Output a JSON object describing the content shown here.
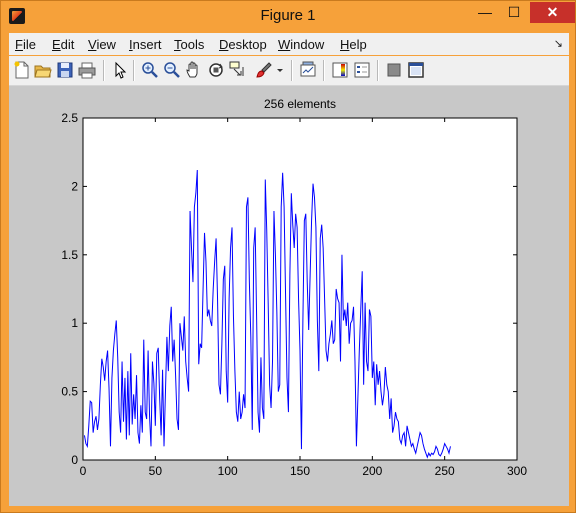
{
  "window": {
    "title": "Figure 1",
    "minimize": "—",
    "maximize": "☐",
    "close": "✕"
  },
  "menu": [
    "File",
    "Edit",
    "View",
    "Insert",
    "Tools",
    "Desktop",
    "Window",
    "Help"
  ],
  "menu_dock_glyph": "↘",
  "toolbar_icons": [
    "new-figure-icon",
    "open-file-icon",
    "save-icon",
    "print-icon",
    "pointer-icon",
    "zoom-in-icon",
    "zoom-out-icon",
    "pan-icon",
    "rotate-3d-icon",
    "data-cursor-icon",
    "brush-icon",
    "brush-dropdown-icon",
    "link-plot-icon",
    "colorbar-icon",
    "legend-icon",
    "hide-plot-tools-icon",
    "show-plot-tools-icon"
  ],
  "colors": {
    "window_frame": "#f6a13a",
    "figure_bg": "#c8c8c8",
    "line": "#0000ff"
  },
  "chart_data": {
    "type": "line",
    "title": "256 elements",
    "xlabel": "",
    "ylabel": "",
    "xlim": [
      0,
      300
    ],
    "ylim": [
      0,
      2.5
    ],
    "xticks": [
      0,
      50,
      100,
      150,
      200,
      250,
      300
    ],
    "xtick_labels": [
      "0",
      "50",
      "100",
      "150",
      "200",
      "250",
      "300"
    ],
    "yticks": [
      0,
      0.5,
      1,
      1.5,
      2,
      2.5
    ],
    "ytick_labels": [
      "0",
      "0.5",
      "1",
      "1.5",
      "2",
      "2.5"
    ],
    "grid": false,
    "series": [
      {
        "x_start": 1,
        "color": "#0000ff",
        "values": [
          0.18,
          0.12,
          0.1,
          0.25,
          0.43,
          0.42,
          0.2,
          0.28,
          0.32,
          0.22,
          0.3,
          0.55,
          0.74,
          0.68,
          0.58,
          0.72,
          0.8,
          0.52,
          0.1,
          0.6,
          0.8,
          0.92,
          1.02,
          0.75,
          0.35,
          0.2,
          0.72,
          0.28,
          0.6,
          0.15,
          0.65,
          0.18,
          0.78,
          0.26,
          0.48,
          0.3,
          0.62,
          0.2,
          0.12,
          0.4,
          0.2,
          0.88,
          0.35,
          0.3,
          0.8,
          0.32,
          0.1,
          0.72,
          0.56,
          0.25,
          0.78,
          0.82,
          0.45,
          0.18,
          0.66,
          0.1,
          0.5,
          0.9,
          0.65,
          0.98,
          1.12,
          0.72,
          0.88,
          0.62,
          0.3,
          0.22,
          1.0,
          0.9,
          0.8,
          1.05,
          0.72,
          0.6,
          0.5,
          1.82,
          1.55,
          1.3,
          1.85,
          1.95,
          2.12,
          0.7,
          0.85,
          0.82,
          1.25,
          1.66,
          1.45,
          1.05,
          1.1,
          1.02,
          0.98,
          1.25,
          1.45,
          1.62,
          1.18,
          0.55,
          0.48,
          0.85,
          1.32,
          1.42,
          0.65,
          0.42,
          1.18,
          1.55,
          1.7,
          1.05,
          0.65,
          0.35,
          0.28,
          0.5,
          0.3,
          0.35,
          0.48,
          0.38,
          1.85,
          1.92,
          1.3,
          0.9,
          0.22,
          1.55,
          1.7,
          1.05,
          0.35,
          0.2,
          0.75,
          0.38,
          0.3,
          2.05,
          1.68,
          1.15,
          0.55,
          0.38,
          0.72,
          1.82,
          1.5,
          1.08,
          0.5,
          0.55,
          1.85,
          2.1,
          1.85,
          1.22,
          0.6,
          0.35,
          1.35,
          1.95,
          1.72,
          1.55,
          1.8,
          1.7,
          1.18,
          0.8,
          0.08,
          1.02,
          1.75,
          1.8,
          1.3,
          0.95,
          1.35,
          1.75,
          2.02,
          1.92,
          1.7,
          1.02,
          0.65,
          1.62,
          1.72,
          1.55,
          1.18,
          0.8,
          0.72,
          0.85,
          0.92,
          1.02,
          0.85,
          0.88,
          1.25,
          1.18,
          1.15,
          0.72,
          1.5,
          1.02,
          1.1,
          0.98,
          1.15,
          0.85,
          1.0,
          1.02,
          1.12,
          0.72,
          0.1,
          0.45,
          0.8,
          1.1,
          1.38,
          0.55,
          1.15,
          0.72,
          0.65,
          1.1,
          1.05,
          0.6,
          0.72,
          0.4,
          0.7,
          0.55,
          0.65,
          0.5,
          0.4,
          0.48,
          0.68,
          0.55,
          0.5,
          0.3,
          0.45,
          0.2,
          0.25,
          0.35,
          0.3,
          0.28,
          0.15,
          0.12,
          0.18,
          0.2,
          0.1,
          0.25,
          0.2,
          0.15,
          0.1,
          0.12,
          0.08,
          0.05,
          0.1,
          0.15,
          0.2,
          0.18,
          0.12,
          0.08,
          0.05,
          0.02,
          0.05,
          0.03,
          0.05,
          0.04,
          0.06,
          0.1,
          0.08,
          0.04,
          0.03,
          0.05,
          0.08,
          0.12,
          0.1,
          0.08,
          0.05,
          0.1
        ]
      }
    ]
  }
}
